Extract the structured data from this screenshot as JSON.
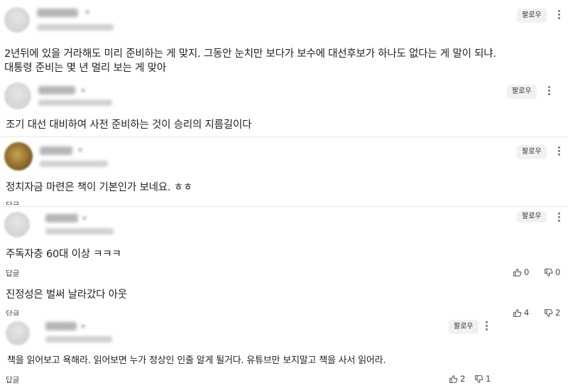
{
  "follow_label": "팔로우",
  "reply_label": "답글",
  "comments": [
    {
      "author": "kang****",
      "date": "2025.03.14. 19:59",
      "lines": [
        "2년뒤에 있을 거라해도 미리 준비하는 게 맞지. 그동안 눈치만 보다가 보수에 대선후보가 하나도 없다는 게 말이 되냐.",
        "대통령 준비는 몇 년 멀리 보는 게 맞아"
      ]
    },
    {
      "author": "ssss****",
      "date": "2025.03.15. 14:37",
      "lines": [
        "조기 대선 대비하여 사전 준비하는 것이 승리의 지름길이다"
      ]
    },
    {
      "author": "aaaa****",
      "date": "",
      "lines": [
        "정치자금 마련은 책이 기본인가 보네요. ㅎㅎ"
      ]
    },
    {
      "author": "xgol****",
      "date": "2025.03.14. 14:40",
      "lines": [
        "주독자층 60대 이상 ㅋㅋㅋ"
      ],
      "likes": "0",
      "dislikes": "0"
    },
    {
      "author": "",
      "date": "",
      "lines": [
        "진정성은 벌써 날라갔다 아웃"
      ],
      "likes": "4",
      "dislikes": "2"
    },
    {
      "author": "kang****",
      "date": "2025.03.15. 15:35",
      "lines": [
        "책을 읽어보고 욕해라. 읽어보면 누가 정상인 인줄 알게 될거다. 유튜브만 보지말고 책을 사서 읽어라."
      ],
      "likes": "2",
      "dislikes": "1"
    }
  ]
}
